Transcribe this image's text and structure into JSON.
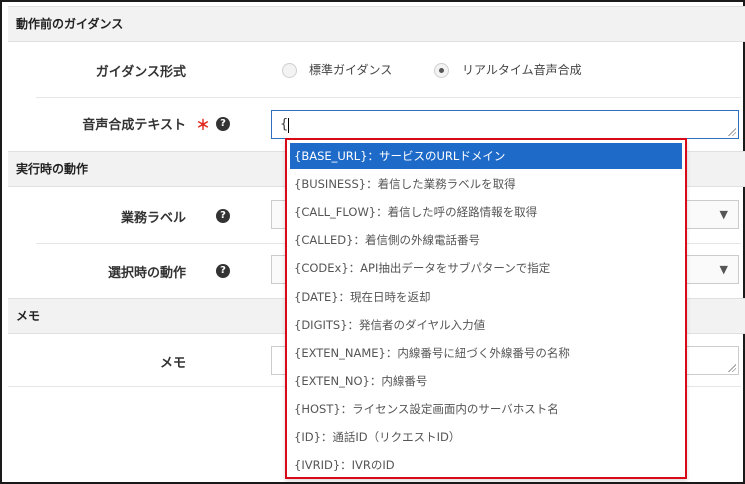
{
  "sections": {
    "guidance": "動作前のガイダンス",
    "execution": "実行時の動作",
    "memo": "メモ"
  },
  "fields": {
    "guidance_type": {
      "label": "ガイダンス形式",
      "options": [
        "標準ガイダンス",
        "リアルタイム音声合成"
      ],
      "selected": "リアルタイム音声合成"
    },
    "tts_text": {
      "label": "音声合成テキスト",
      "value": "{"
    },
    "business_label": {
      "label": "業務ラベル",
      "value": ""
    },
    "select_action": {
      "label": "選択時の動作",
      "value": ""
    },
    "memo": {
      "label": "メモ",
      "value": ""
    }
  },
  "help_icon_glyph": "?",
  "required_mark": "＊",
  "dropdown": {
    "items": [
      "{BASE_URL}：サービスのURLドメイン",
      "{BUSINESS}：着信した業務ラベルを取得",
      "{CALL_FLOW}：着信した呼の経路情報を取得",
      "{CALLED}：着信側の外線電話番号",
      "{CODEx}：API抽出データをサブパターンで指定",
      "{DATE}：現在日時を返却",
      "{DIGITS}：発信者のダイヤル入力値",
      "{EXTEN_NAME}：内線番号に紐づく外線番号の名称",
      "{EXTEN_NO}：内線番号",
      "{HOST}：ライセンス設定画面内のサーバホスト名",
      "{ID}：通話ID（リクエストID）",
      "{IVRID}：IVRのID"
    ],
    "highlighted_index": 0,
    "highlight_color": "#1e6ac8",
    "border_color": "#d90a17"
  }
}
